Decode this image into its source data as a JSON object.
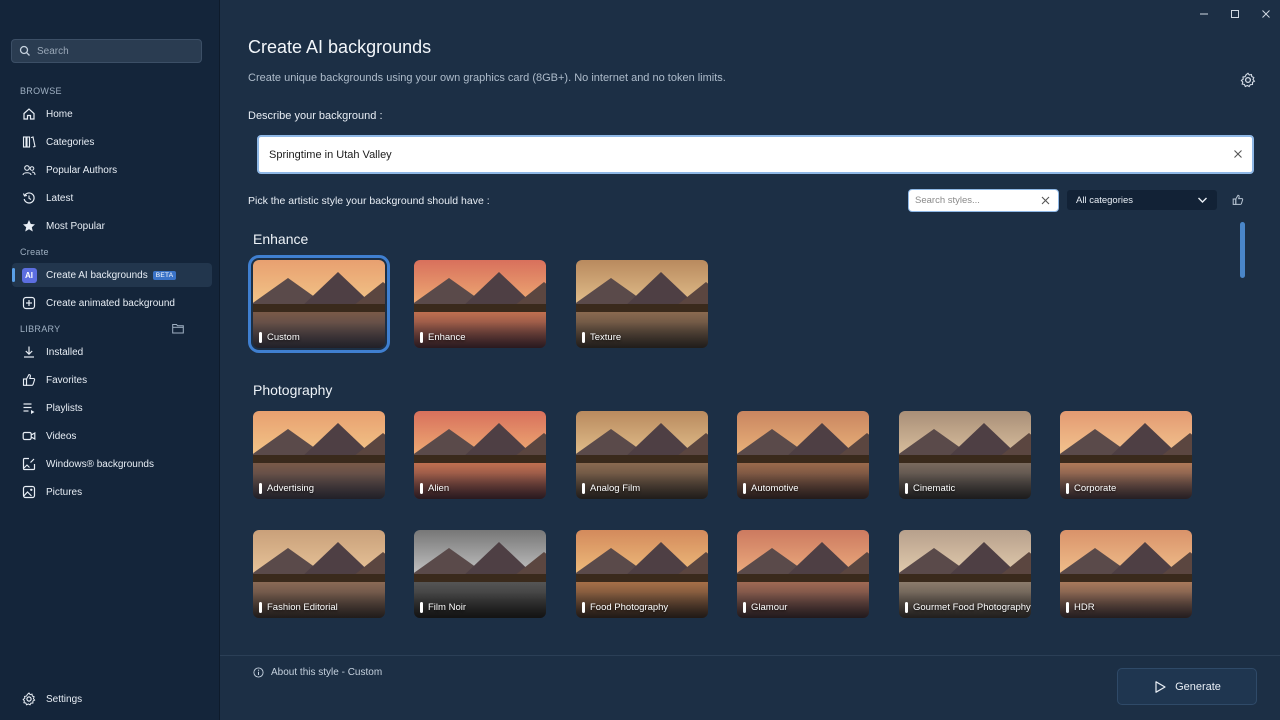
{
  "sidebar": {
    "search_placeholder": "Search",
    "browse_label": "BROWSE",
    "browse": [
      {
        "label": "Home"
      },
      {
        "label": "Categories"
      },
      {
        "label": "Popular Authors"
      },
      {
        "label": "Latest"
      },
      {
        "label": "Most Popular"
      }
    ],
    "create_label": "Create",
    "create": [
      {
        "label": "Create AI backgrounds",
        "badge": "BETA",
        "icon_text": "AI"
      },
      {
        "label": "Create animated background"
      }
    ],
    "library_label": "LIBRARY",
    "library": [
      {
        "label": "Installed"
      },
      {
        "label": "Favorites"
      },
      {
        "label": "Playlists"
      },
      {
        "label": "Videos"
      },
      {
        "label": "Windows® backgrounds"
      },
      {
        "label": "Pictures"
      }
    ],
    "settings_label": "Settings"
  },
  "main": {
    "title": "Create AI backgrounds",
    "subtitle": "Create unique backgrounds using your own graphics card (8GB+). No internet and no token limits.",
    "describe_label": "Describe your background :",
    "prompt_value": "Springtime in Utah Valley",
    "pick_label": "Pick the artistic style your background should have :",
    "style_search_placeholder": "Search styles...",
    "category_selected": "All categories",
    "groups": [
      {
        "title": "Enhance",
        "styles": [
          {
            "label": "Custom",
            "selected": true
          },
          {
            "label": "Enhance"
          },
          {
            "label": "Texture"
          }
        ]
      },
      {
        "title": "Photography",
        "styles": [
          {
            "label": "Advertising"
          },
          {
            "label": "Alien"
          },
          {
            "label": "Analog Film"
          },
          {
            "label": "Automotive"
          },
          {
            "label": "Cinematic"
          },
          {
            "label": "Corporate"
          },
          {
            "label": "Fashion Editorial"
          },
          {
            "label": "Film Noir"
          },
          {
            "label": "Food Photography"
          },
          {
            "label": "Glamour"
          },
          {
            "label": "Gourmet Food Photography"
          },
          {
            "label": "HDR"
          }
        ]
      }
    ],
    "about_label": "About this style - Custom",
    "generate_label": "Generate"
  },
  "colors": {
    "accent": "#3f7fd0",
    "sidebar_bg": "#14253a",
    "main_bg": "#1c2f45"
  }
}
